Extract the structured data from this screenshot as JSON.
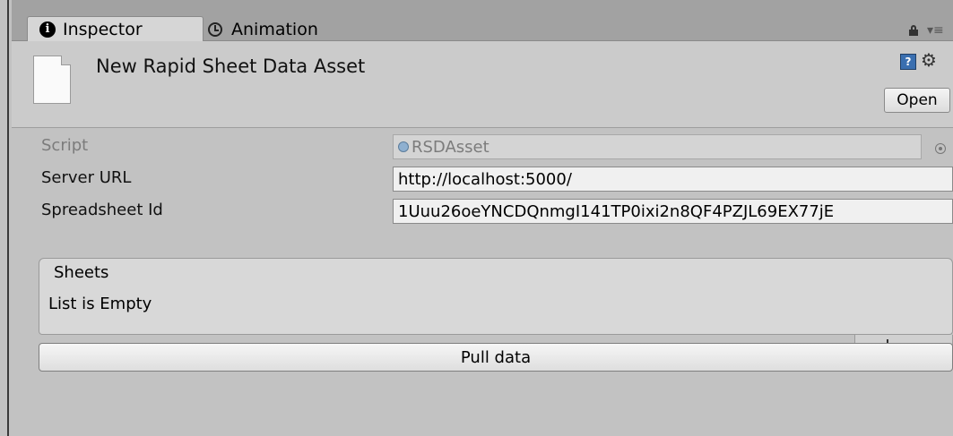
{
  "tabs": [
    {
      "label": "Inspector",
      "icon": "info-icon",
      "active": true
    },
    {
      "label": "Animation",
      "icon": "clock-icon",
      "active": false
    }
  ],
  "header": {
    "title": "New Rapid Sheet Data Asset",
    "open_label": "Open",
    "help_glyph": "?"
  },
  "fields": {
    "script": {
      "label": "Script",
      "value": "RSDAsset"
    },
    "server_url": {
      "label": "Server URL",
      "value": "http://localhost:5000/"
    },
    "spreadsheet_id": {
      "label": "Spreadsheet Id",
      "value": "1Uuu26oeYNCDQnmgI141TP0ixi2n8QF4PZJL69EX77jE"
    }
  },
  "sheets": {
    "label": "Sheets",
    "empty_text": "List is Empty",
    "add_label": "+",
    "remove_label": "−"
  },
  "pull_button_label": "Pull data",
  "colors": {
    "background": "#c2c2c2",
    "header": "#cbcbcb",
    "active_tab": "#d6d6d6",
    "help_icon": "#3a6fb0"
  }
}
